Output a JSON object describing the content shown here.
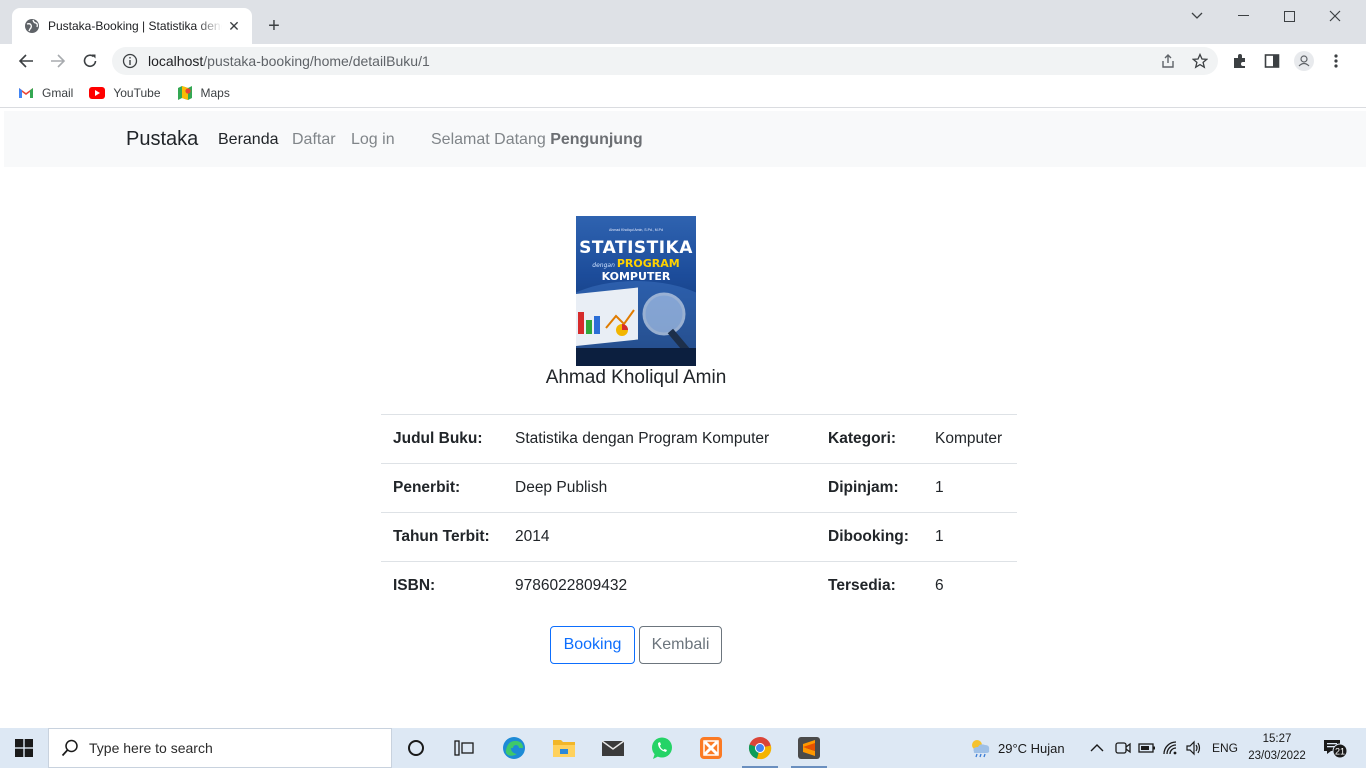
{
  "browser": {
    "tab_title": "Pustaka-Booking | Statistika dengan Program Komputer",
    "url_host": "localhost",
    "url_path": "/pustaka-booking/home/detailBuku/1",
    "bookmarks": [
      {
        "label": "Gmail",
        "icon": "gmail-icon"
      },
      {
        "label": "YouTube",
        "icon": "youtube-icon"
      },
      {
        "label": "Maps",
        "icon": "maps-icon"
      }
    ]
  },
  "navbar": {
    "brand": "Pustaka",
    "links": [
      {
        "label": "Beranda",
        "active": true
      },
      {
        "label": "Daftar",
        "active": false
      },
      {
        "label": "Log in",
        "active": false
      }
    ],
    "welcome_prefix": "Selamat Datang",
    "welcome_user": "Pengunjung"
  },
  "book": {
    "cover": {
      "author_line": "Ahmad Kholiqul Amin, S.Pd., M.Pd",
      "title_line1": "STATISTIKA",
      "title_connector": "dengan",
      "title_line2": "PROGRAM",
      "title_line3": "KOMPUTER"
    },
    "author": "Ahmad Kholiqul Amin",
    "rows": [
      {
        "label": "Judul Buku:",
        "value": "Statistika dengan Program Komputer",
        "label2": "Kategori:",
        "value2": "Komputer"
      },
      {
        "label": "Penerbit:",
        "value": "Deep Publish",
        "label2": "Dipinjam:",
        "value2": "1"
      },
      {
        "label": "Tahun Terbit:",
        "value": "2014",
        "label2": "Dibooking:",
        "value2": "1"
      },
      {
        "label": "ISBN:",
        "value": "9786022809432",
        "label2": "Tersedia:",
        "value2": "6"
      }
    ]
  },
  "actions": {
    "booking": "Booking",
    "back": "Kembali"
  },
  "taskbar": {
    "search_placeholder": "Type here to search",
    "weather": "29°C  Hujan",
    "language": "ENG",
    "time": "15:27",
    "date": "23/03/2022",
    "notifications": "21"
  },
  "colors": {
    "primary": "#0d6efd",
    "secondary": "#6c757d",
    "navbar_bg": "#f8f9fa"
  }
}
